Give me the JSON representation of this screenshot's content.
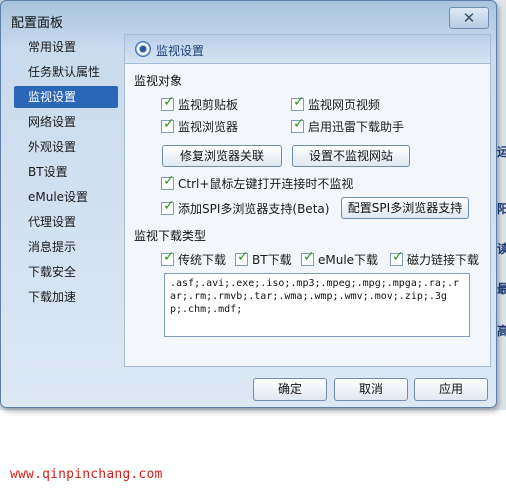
{
  "background": {
    "watermark": "www.qinpinchang.com",
    "fragments": [
      "运",
      "阳",
      "读",
      "最",
      "高"
    ]
  },
  "dialog": {
    "title": "配置面板",
    "close_glyph": "✕"
  },
  "sidebar": {
    "items": [
      {
        "label": "常用设置"
      },
      {
        "label": "任务默认属性"
      },
      {
        "label": "监视设置",
        "active": true
      },
      {
        "label": "网络设置"
      },
      {
        "label": "外观设置"
      },
      {
        "label": "BT设置"
      },
      {
        "label": "eMule设置"
      },
      {
        "label": "代理设置"
      },
      {
        "label": "消息提示"
      },
      {
        "label": "下载安全"
      },
      {
        "label": "下载加速"
      }
    ]
  },
  "panel": {
    "title": "监视设置",
    "icon": "monitor-eye-icon",
    "monitor_objects_label": "监视对象",
    "monitor_options": [
      {
        "label": "监视剪贴板",
        "checked": true
      },
      {
        "label": "监视网页视频",
        "checked": true
      },
      {
        "label": "监视浏览器",
        "checked": true
      },
      {
        "label": "启用迅雷下载助手",
        "checked": true
      }
    ],
    "repair_button": "修复浏览器关联",
    "no_monitor_sites_button": "设置不监视网站",
    "ctrl_option": {
      "label": "Ctrl+鼠标左键打开连接时不监视",
      "checked": true
    },
    "spi_option": {
      "label": "添加SPI多浏览器支持(Beta)",
      "checked": true
    },
    "spi_button": "配置SPI多浏览器支持",
    "download_types_label": "监视下载类型",
    "download_types": [
      {
        "label": "传统下载",
        "checked": true
      },
      {
        "label": "BT下载",
        "checked": true
      },
      {
        "label": "eMule下载",
        "checked": true
      },
      {
        "label": "磁力链接下载",
        "checked": true
      }
    ],
    "extensions": ".asf;.avi;.exe;.iso;.mp3;.mpeg;.mpg;.mpga;.ra;.rar;.rm;.rmvb;.tar;.wma;.wmp;.wmv;.mov;.zip;.3gp;.chm;.mdf;"
  },
  "footer": {
    "ok": "确定",
    "cancel": "取消",
    "apply": "应用"
  },
  "colors": {
    "accent": "#2b67b6",
    "check": "#2c9a23",
    "watermark": "#d4201a"
  }
}
